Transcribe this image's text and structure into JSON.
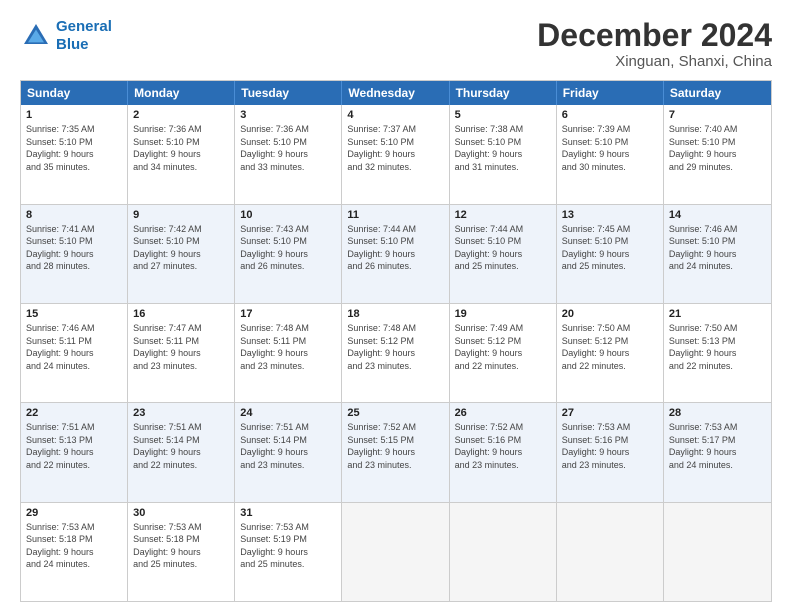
{
  "header": {
    "logo_line1": "General",
    "logo_line2": "Blue",
    "title": "December 2024",
    "subtitle": "Xinguan, Shanxi, China"
  },
  "calendar": {
    "headers": [
      "Sunday",
      "Monday",
      "Tuesday",
      "Wednesday",
      "Thursday",
      "Friday",
      "Saturday"
    ],
    "weeks": [
      [
        {
          "day": "",
          "info": "",
          "empty": true
        },
        {
          "day": "2",
          "info": "Sunrise: 7:36 AM\nSunset: 5:10 PM\nDaylight: 9 hours\nand 34 minutes."
        },
        {
          "day": "3",
          "info": "Sunrise: 7:36 AM\nSunset: 5:10 PM\nDaylight: 9 hours\nand 33 minutes."
        },
        {
          "day": "4",
          "info": "Sunrise: 7:37 AM\nSunset: 5:10 PM\nDaylight: 9 hours\nand 32 minutes."
        },
        {
          "day": "5",
          "info": "Sunrise: 7:38 AM\nSunset: 5:10 PM\nDaylight: 9 hours\nand 31 minutes."
        },
        {
          "day": "6",
          "info": "Sunrise: 7:39 AM\nSunset: 5:10 PM\nDaylight: 9 hours\nand 30 minutes."
        },
        {
          "day": "7",
          "info": "Sunrise: 7:40 AM\nSunset: 5:10 PM\nDaylight: 9 hours\nand 29 minutes."
        }
      ],
      [
        {
          "day": "1",
          "info": "Sunrise: 7:35 AM\nSunset: 5:10 PM\nDaylight: 9 hours\nand 35 minutes."
        },
        {
          "day": "",
          "info": "",
          "empty": true
        },
        {
          "day": "",
          "info": "",
          "empty": true
        },
        {
          "day": "",
          "info": "",
          "empty": true
        },
        {
          "day": "",
          "info": "",
          "empty": true
        },
        {
          "day": "",
          "info": "",
          "empty": true
        },
        {
          "day": "",
          "info": "",
          "empty": true
        }
      ],
      [
        {
          "day": "8",
          "info": "Sunrise: 7:41 AM\nSunset: 5:10 PM\nDaylight: 9 hours\nand 28 minutes."
        },
        {
          "day": "9",
          "info": "Sunrise: 7:42 AM\nSunset: 5:10 PM\nDaylight: 9 hours\nand 27 minutes."
        },
        {
          "day": "10",
          "info": "Sunrise: 7:43 AM\nSunset: 5:10 PM\nDaylight: 9 hours\nand 26 minutes."
        },
        {
          "day": "11",
          "info": "Sunrise: 7:44 AM\nSunset: 5:10 PM\nDaylight: 9 hours\nand 26 minutes."
        },
        {
          "day": "12",
          "info": "Sunrise: 7:44 AM\nSunset: 5:10 PM\nDaylight: 9 hours\nand 25 minutes."
        },
        {
          "day": "13",
          "info": "Sunrise: 7:45 AM\nSunset: 5:10 PM\nDaylight: 9 hours\nand 25 minutes."
        },
        {
          "day": "14",
          "info": "Sunrise: 7:46 AM\nSunset: 5:10 PM\nDaylight: 9 hours\nand 24 minutes."
        }
      ],
      [
        {
          "day": "15",
          "info": "Sunrise: 7:46 AM\nSunset: 5:11 PM\nDaylight: 9 hours\nand 24 minutes."
        },
        {
          "day": "16",
          "info": "Sunrise: 7:47 AM\nSunset: 5:11 PM\nDaylight: 9 hours\nand 23 minutes."
        },
        {
          "day": "17",
          "info": "Sunrise: 7:48 AM\nSunset: 5:11 PM\nDaylight: 9 hours\nand 23 minutes."
        },
        {
          "day": "18",
          "info": "Sunrise: 7:48 AM\nSunset: 5:12 PM\nDaylight: 9 hours\nand 23 minutes."
        },
        {
          "day": "19",
          "info": "Sunrise: 7:49 AM\nSunset: 5:12 PM\nDaylight: 9 hours\nand 22 minutes."
        },
        {
          "day": "20",
          "info": "Sunrise: 7:50 AM\nSunset: 5:12 PM\nDaylight: 9 hours\nand 22 minutes."
        },
        {
          "day": "21",
          "info": "Sunrise: 7:50 AM\nSunset: 5:13 PM\nDaylight: 9 hours\nand 22 minutes."
        }
      ],
      [
        {
          "day": "22",
          "info": "Sunrise: 7:51 AM\nSunset: 5:13 PM\nDaylight: 9 hours\nand 22 minutes."
        },
        {
          "day": "23",
          "info": "Sunrise: 7:51 AM\nSunset: 5:14 PM\nDaylight: 9 hours\nand 22 minutes."
        },
        {
          "day": "24",
          "info": "Sunrise: 7:51 AM\nSunset: 5:14 PM\nDaylight: 9 hours\nand 23 minutes."
        },
        {
          "day": "25",
          "info": "Sunrise: 7:52 AM\nSunset: 5:15 PM\nDaylight: 9 hours\nand 23 minutes."
        },
        {
          "day": "26",
          "info": "Sunrise: 7:52 AM\nSunset: 5:16 PM\nDaylight: 9 hours\nand 23 minutes."
        },
        {
          "day": "27",
          "info": "Sunrise: 7:53 AM\nSunset: 5:16 PM\nDaylight: 9 hours\nand 23 minutes."
        },
        {
          "day": "28",
          "info": "Sunrise: 7:53 AM\nSunset: 5:17 PM\nDaylight: 9 hours\nand 24 minutes."
        }
      ],
      [
        {
          "day": "29",
          "info": "Sunrise: 7:53 AM\nSunset: 5:18 PM\nDaylight: 9 hours\nand 24 minutes."
        },
        {
          "day": "30",
          "info": "Sunrise: 7:53 AM\nSunset: 5:18 PM\nDaylight: 9 hours\nand 25 minutes."
        },
        {
          "day": "31",
          "info": "Sunrise: 7:53 AM\nSunset: 5:19 PM\nDaylight: 9 hours\nand 25 minutes."
        },
        {
          "day": "",
          "info": "",
          "empty": true
        },
        {
          "day": "",
          "info": "",
          "empty": true
        },
        {
          "day": "",
          "info": "",
          "empty": true
        },
        {
          "day": "",
          "info": "",
          "empty": true
        }
      ]
    ]
  }
}
